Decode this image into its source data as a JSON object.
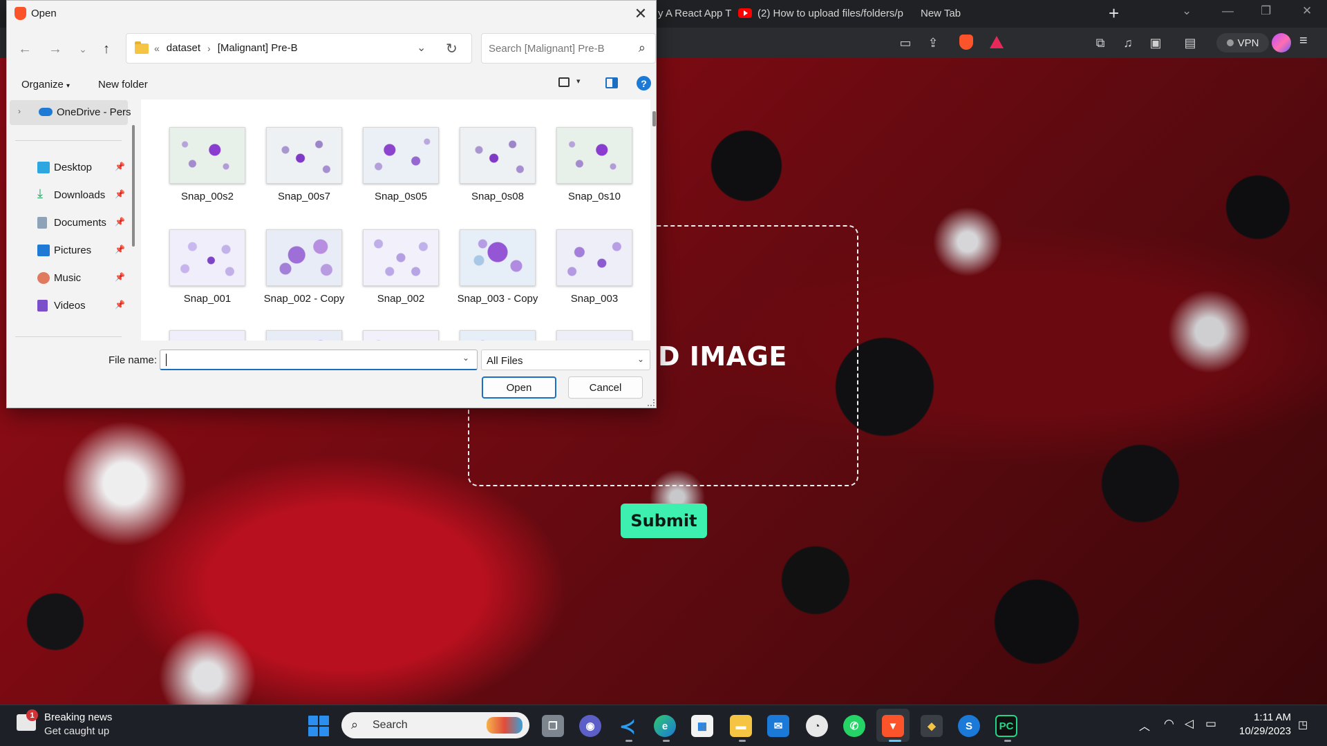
{
  "browser": {
    "tabs": [
      {
        "label": "y A React App T"
      },
      {
        "label": "(2) How to upload files/folders/p"
      },
      {
        "label": "New Tab"
      }
    ],
    "new_tab_symbol": "+",
    "vpn_label": "VPN"
  },
  "page": {
    "upload_text": "D IMAGE",
    "submit_label": "Submit",
    "submit_color": "#3ef0b0"
  },
  "dialog": {
    "title": "Open",
    "breadcrumb": {
      "overflow": "«",
      "items": [
        "dataset",
        "[Malignant] Pre-B"
      ]
    },
    "search_placeholder": "Search [Malignant] Pre-B",
    "commands": {
      "organize": "Organize",
      "new_folder": "New folder",
      "help": "?"
    },
    "nav": {
      "onedrive": "OneDrive - Perso",
      "items": [
        {
          "label": "Desktop",
          "icon": "desktop-icon"
        },
        {
          "label": "Downloads",
          "icon": "downloads-icon"
        },
        {
          "label": "Documents",
          "icon": "documents-icon"
        },
        {
          "label": "Pictures",
          "icon": "pictures-icon"
        },
        {
          "label": "Music",
          "icon": "music-icon"
        },
        {
          "label": "Videos",
          "icon": "videos-icon"
        }
      ]
    },
    "files": [
      "Snap_00s2",
      "Snap_00s7",
      "Snap_0s05",
      "Snap_0s08",
      "Snap_0s10",
      "Snap_001",
      "Snap_002 - Copy",
      "Snap_002",
      "Snap_003 - Copy",
      "Snap_003"
    ],
    "file_name_label": "File name:",
    "file_name_value": "",
    "file_type": "All Files",
    "open_label": "Open",
    "cancel_label": "Cancel",
    "accent_color": "#1b6fc2"
  },
  "taskbar": {
    "news_title": "Breaking news",
    "news_subtitle": "Get caught up",
    "news_badge": "1",
    "search_text": "Search",
    "time": "1:11 AM",
    "date": "10/29/2023"
  }
}
